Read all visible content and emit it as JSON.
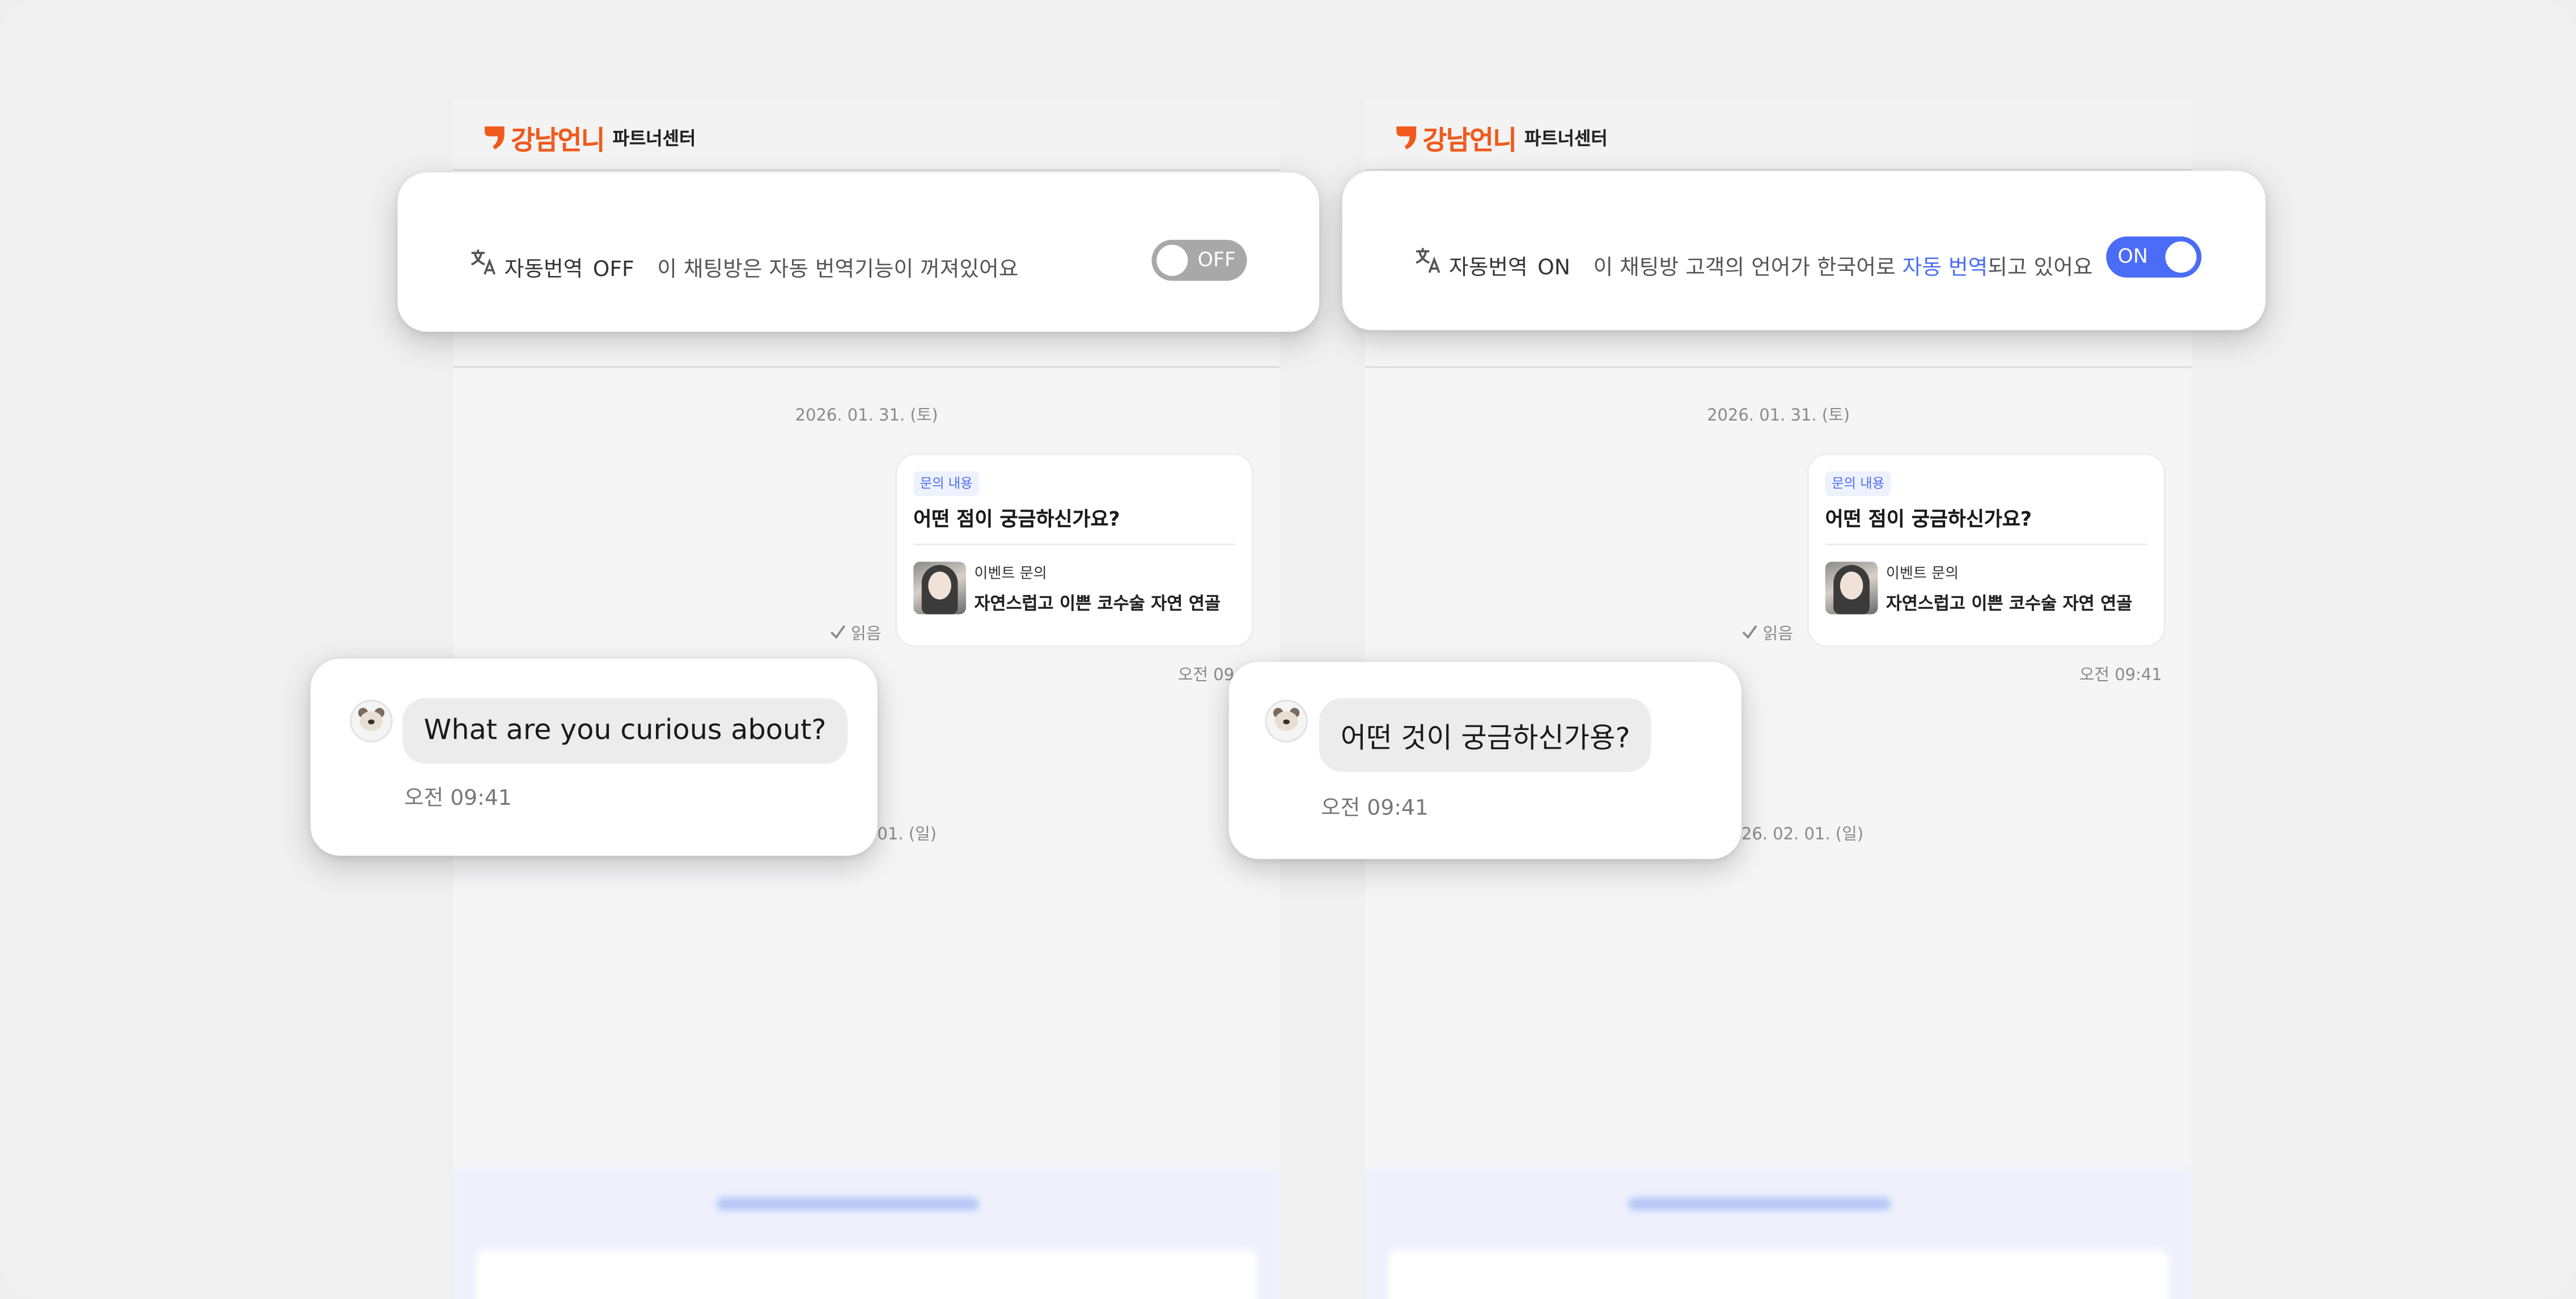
{
  "colors": {
    "brand_orange": "#f05a1c",
    "accent_blue": "#4a6cf7",
    "toggle_off": "#a8a8a8"
  },
  "brand": {
    "name": "강남언니",
    "sub": "파트너센터"
  },
  "chat": {
    "date_1": "2026. 01. 31. (토)",
    "date_2_partial_left": "01. (일)",
    "date_2_partial_right": "26. 02. 01. (일)",
    "inquiry": {
      "tag": "문의 내용",
      "title": "어떤 점이 궁금하신가요?",
      "event_label": "이벤트 문의",
      "event_name": "자연스럽고 이쁜 코수술 자연 연골"
    },
    "read_label": "읽음",
    "time_left_partial": "오전 09:4",
    "time_right": "오전 09:41"
  },
  "translation_off": {
    "label": "자동번역",
    "state": "OFF",
    "description": "이 채팅방은 자동 번역기능이 꺼져있어요",
    "toggle_text": "OFF",
    "toggle_on": false
  },
  "translation_on": {
    "label": "자동번역",
    "state": "ON",
    "description_before": "이 채팅방 고객의 언어가 한국어로 ",
    "description_highlight": "자동 번역",
    "description_after": "되고 있어요",
    "toggle_text": "ON",
    "toggle_on": true
  },
  "message_en": {
    "text": "What are you curious about?",
    "time": "오전 09:41"
  },
  "message_ko": {
    "text": "어떤 것이 궁금하신가용?",
    "time": "오전 09:41"
  }
}
